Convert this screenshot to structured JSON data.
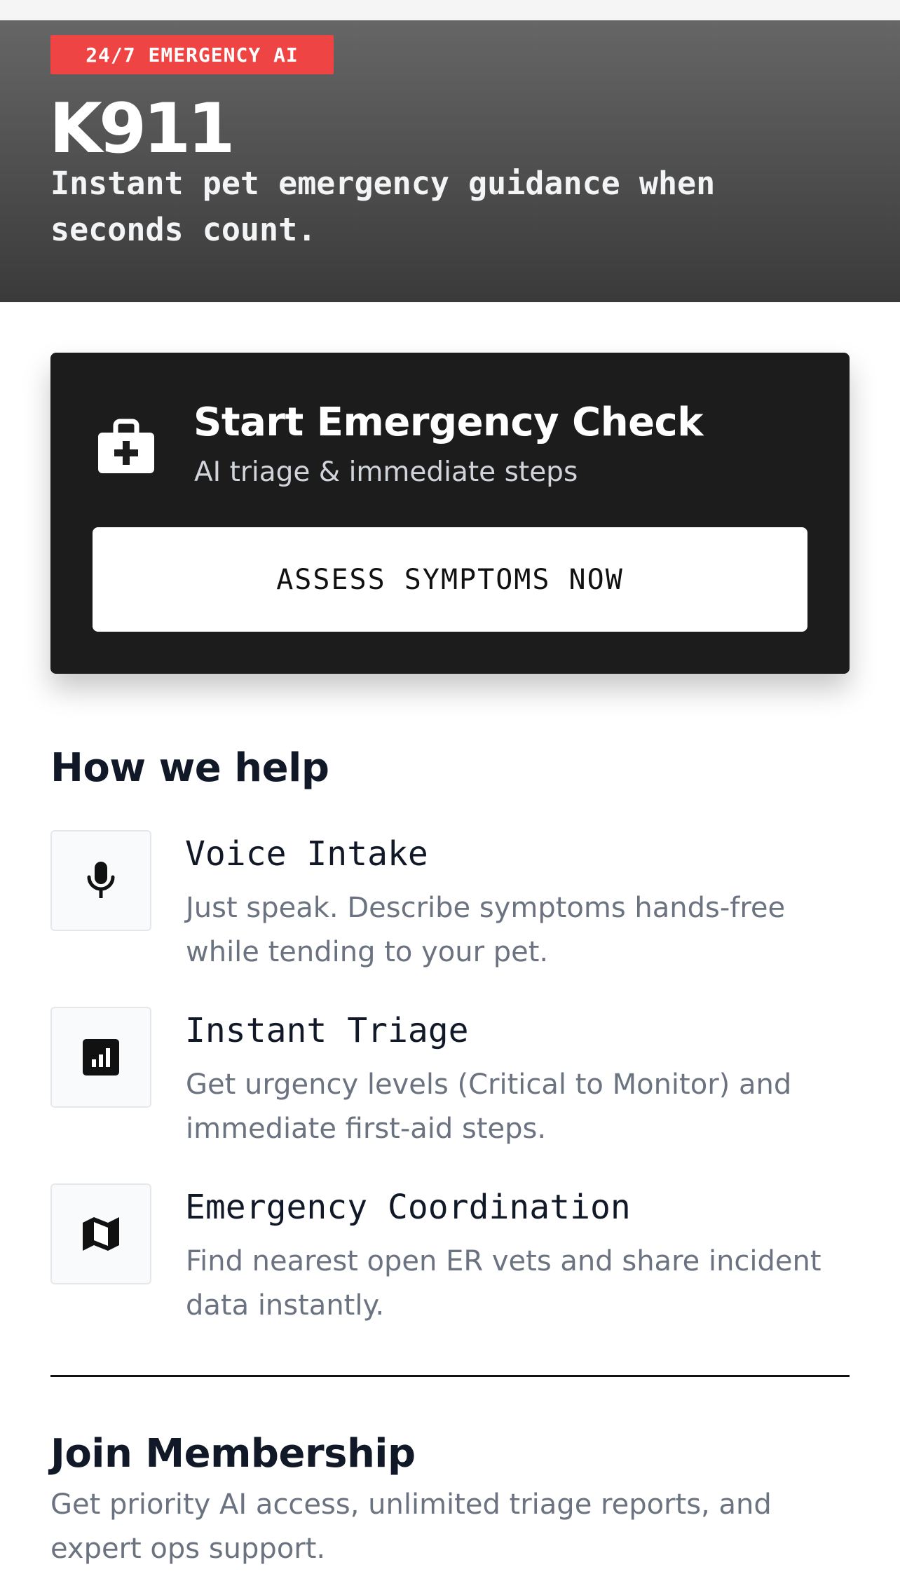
{
  "hero": {
    "badge": "24/7 EMERGENCY AI",
    "title": "K911",
    "tagline": "Instant pet emergency guidance when seconds count."
  },
  "emergency_card": {
    "icon": "first-aid-kit-icon",
    "title": "Start Emergency Check",
    "subtitle": "AI triage & immediate steps",
    "button_label": "ASSESS SYMPTOMS NOW"
  },
  "how_we_help": {
    "heading": "How we help",
    "features": [
      {
        "icon": "microphone-icon",
        "title": "Voice Intake",
        "description": "Just speak. Describe symptoms hands-free while tending to your pet."
      },
      {
        "icon": "bar-chart-icon",
        "title": "Instant Triage",
        "description": "Get urgency levels (Critical to Monitor) and immediate first-aid steps."
      },
      {
        "icon": "map-icon",
        "title": "Emergency Coordination",
        "description": "Find nearest open ER vets and share incident data instantly."
      }
    ]
  },
  "membership": {
    "title": "Join Membership",
    "description": "Get priority AI access, unlimited triage reports, and expert ops support."
  },
  "colors": {
    "badge_red": "#ef4444",
    "card_dark": "#1c1c1c",
    "text_dark": "#111827",
    "text_muted": "#6b7280"
  }
}
